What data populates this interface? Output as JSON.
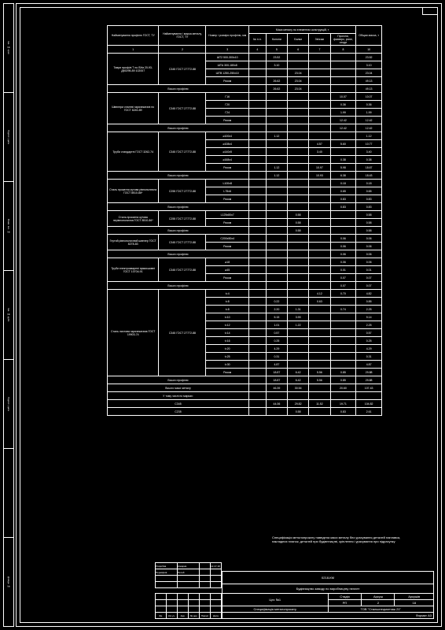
{
  "header": {
    "mass_title": "Маса металу по елементах конструкцій, т",
    "cols": [
      "Найменування профілю ГОСТ, ТУ",
      "Найменування і марка металу, ГОСТ, ТУ",
      "Номер і розміри профілю, мм",
      "№ п.п.",
      "Колoни",
      "Балки",
      "Зв'язки",
      "Прогони, фахверк, різне, сходи",
      "Общая масса, т"
    ],
    "nums": [
      "1",
      "2",
      "3",
      "4",
      "5",
      "6",
      "7",
      "8",
      "9",
      "10"
    ]
  },
  "sections": [
    {
      "name": "Таври профілі Т по ВУм 20-93-ДМЗ/95-89 102007",
      "mat": "С345 ГОСТ 27772-88",
      "rows": [
        {
          "p": "ШТ2 500-300x10",
          "c4": "",
          "c5": "23.52",
          "c6": "",
          "c7": "",
          "c8": "",
          "c9": "23.52"
        },
        {
          "p": "ШТА 300-180x8",
          "c4": "",
          "c5": "3.10",
          "c6": "",
          "c7": "",
          "c8": "",
          "c9": "3.10"
        },
        {
          "p": "ШТВ 1250-250x10",
          "c4": "",
          "c5": "",
          "c6": "23.04",
          "c7": "",
          "c8": "",
          "c9": "23.04"
        },
        {
          "p": "Разом",
          "c4": "",
          "c5": "26.62",
          "c6": "23.04",
          "c7": "",
          "c8": "",
          "c9": "49.13"
        }
      ],
      "total": {
        "p": "Всього профілю",
        "c5": "26.62",
        "c6": "23.04",
        "c7": "",
        "c8": "",
        "c9": "49.13"
      }
    },
    {
      "name": "Швелери сталеві гарячекатані по ГОСТ 8240-89",
      "mat": "С345 ГОСТ 27772-88",
      "rows": [
        {
          "p": "Г16",
          "c4": "",
          "c5": "",
          "c6": "",
          "c7": "",
          "c8": "10.07",
          "c9": "10.07"
        },
        {
          "p": "Г20",
          "c4": "",
          "c5": "",
          "c6": "",
          "c7": "",
          "c8": "0.36",
          "c9": "0.36"
        },
        {
          "p": "Г24",
          "c4": "",
          "c5": "",
          "c6": "",
          "c7": "",
          "c8": "1.99",
          "c9": "1.99"
        },
        {
          "p": "Разом",
          "c4": "",
          "c5": "",
          "c6": "",
          "c7": "",
          "c8": "12.42",
          "c9": "12.42"
        }
      ],
      "total": {
        "p": "Всього профілю",
        "c5": "",
        "c6": "",
        "c7": "",
        "c8": "12.42",
        "c9": "12.42"
      }
    },
    {
      "name": "Труби стандартні ГОСТ 3262-74",
      "mat": "С345 ГОСТ 27772-88",
      "rows": [
        {
          "p": "⌀100x4",
          "c4": "",
          "c5": "1.12",
          "c6": "",
          "c7": "",
          "c8": "",
          "c9": "1.12"
        },
        {
          "p": "⌀108x4",
          "c4": "",
          "c5": "",
          "c6": "",
          "c7": "4.57",
          "c8": "5.60",
          "c9": "10.77"
        },
        {
          "p": "⌀140x5",
          "c4": "",
          "c5": "",
          "c6": "",
          "c7": "3.40",
          "c8": "",
          "c9": "3.40"
        },
        {
          "p": "⌀168x4",
          "c4": "",
          "c5": "",
          "c6": "",
          "c7": "",
          "c8": "0.38",
          "c9": "0.38"
        },
        {
          "p": "Разом",
          "c4": "",
          "c5": "1.12",
          "c6": "",
          "c7": "10.97",
          "c8": "5.98",
          "c9": "18.67"
        }
      ],
      "total": {
        "p": "Всього профілю",
        "c5": "1.12",
        "c6": "",
        "c7": "10.93",
        "c8": "6.38",
        "c9": "18.43"
      }
    },
    {
      "name": "Сталь прокатна кутова рівнополична ГОСТ 8510-86*",
      "mat": "С255 ГОСТ 27772-88",
      "rows": [
        {
          "p": "L100x8",
          "c4": "",
          "c5": "",
          "c6": "",
          "c7": "",
          "c8": "0.18",
          "c9": "0.18"
        },
        {
          "p": "L75x6",
          "c4": "",
          "c5": "",
          "c6": "",
          "c7": "",
          "c8": "0.65",
          "c9": "0.65"
        },
        {
          "p": "Разом",
          "c4": "",
          "c5": "",
          "c6": "",
          "c7": "",
          "c8": "0.83",
          "c9": "0.83"
        }
      ],
      "total": {
        "p": "Всього профілю",
        "c5": "",
        "c6": "",
        "c7": "",
        "c8": "0.83",
        "c9": "0.83"
      }
    },
    {
      "name": "Сталь прокатна кутова нерівнополична ГОСТ 8510-86*",
      "mat": "С255 ГОСТ 27772-88",
      "rows": [
        {
          "p": "L125x80x7",
          "c4": "",
          "c5": "",
          "c6": "0.58",
          "c7": "",
          "c8": "",
          "c9": "0.58"
        },
        {
          "p": "Разом",
          "c4": "",
          "c5": "",
          "c6": "0.58",
          "c7": "",
          "c8": "",
          "c9": "0.58"
        }
      ],
      "total": {
        "p": "Всього профілю",
        "c5": "",
        "c6": "0.58",
        "c7": "",
        "c8": "",
        "c9": "0.58"
      }
    },
    {
      "name": "Гнутий рівнополичний швелер ГОСТ 8278-83",
      "mat": "С345 ГОСТ 27772-88",
      "rows": [
        {
          "p": "С200x50x4",
          "c4": "",
          "c5": "",
          "c6": "",
          "c7": "",
          "c8": "0.06",
          "c9": "0.06"
        },
        {
          "p": "Разом",
          "c4": "",
          "c5": "",
          "c6": "",
          "c7": "",
          "c8": "0.06",
          "c9": "0.06"
        }
      ],
      "total": {
        "p": "Всього профілю",
        "c5": "",
        "c6": "",
        "c7": "",
        "c8": "0.06",
        "c9": "0.06"
      }
    },
    {
      "name": "Труби електрозварені прямошовні ГОСТ 10704-91",
      "mat": "С345 ГОСТ 27772-88",
      "rows": [
        {
          "p": "⌀18",
          "c4": "",
          "c5": "",
          "c6": "",
          "c7": "",
          "c8": "0.06",
          "c9": "0.06"
        },
        {
          "p": "⌀45",
          "c4": "",
          "c5": "",
          "c6": "",
          "c7": "",
          "c8": "0.01",
          "c9": "0.01"
        },
        {
          "p": "Разом",
          "c4": "",
          "c5": "",
          "c6": "",
          "c7": "",
          "c8": "0.07",
          "c9": "0.07"
        }
      ],
      "total": {
        "p": "Всього профілю",
        "c5": "",
        "c6": "",
        "c7": "",
        "c8": "0.07",
        "c9": "0.07"
      }
    },
    {
      "name": "Сталь листова гарячекатана ГОСТ 19903-74",
      "mat": "С345 ГОСТ 27772-88",
      "rows": [
        {
          "p": "t=4",
          "c4": "",
          "c5": "",
          "c6": "",
          "c7": "4.12",
          "c8": "0.70",
          "c9": "4.82"
        },
        {
          "p": "t=8",
          "c4": "",
          "c5": "0.22",
          "c6": "",
          "c7": "0.63",
          "c8": "",
          "c9": "0.85"
        },
        {
          "p": "t=8",
          "c4": "",
          "c5": "2.20",
          "c6": "1.31",
          "c7": "",
          "c8": "0.74",
          "c9": "2.25"
        },
        {
          "p": "t=10",
          "c4": "",
          "c5": "5.15",
          "c6": "3.99",
          "c7": "",
          "c8": "",
          "c9": "9.14"
        },
        {
          "p": "t=12",
          "c4": "",
          "c5": "1.01",
          "c6": "1.22",
          "c7": "",
          "c8": "",
          "c9": "2.25"
        },
        {
          "p": "t=14",
          "c4": "",
          "c5": "0.57",
          "c6": "",
          "c7": "",
          "c8": "",
          "c9": "0.57"
        },
        {
          "p": "t=16",
          "c4": "",
          "c5": "0.25",
          "c6": "",
          "c7": "",
          "c8": "",
          "c9": "0.25"
        },
        {
          "p": "t=20",
          "c4": "",
          "c5": "4.29",
          "c6": "",
          "c7": "",
          "c8": "",
          "c9": "4.29"
        },
        {
          "p": "t=25",
          "c4": "",
          "c5": "0.31",
          "c6": "",
          "c7": "",
          "c8": "",
          "c9": "0.31"
        },
        {
          "p": "t=30",
          "c4": "",
          "c5": "4.87",
          "c6": "",
          "c7": "",
          "c8": "",
          "c9": "4.87"
        },
        {
          "p": "Разом",
          "c4": "",
          "c5": "18.87",
          "c6": "6.42",
          "c7": "5.56",
          "c8": "0.85",
          "c9": "29.88"
        }
      ],
      "total": {
        "p": "Всього профілю",
        "c5": "18.87",
        "c6": "6.42",
        "c7": "5.56",
        "c8": "0.85",
        "c9": "29.88"
      }
    }
  ],
  "totals": [
    {
      "p": "Всього маси металу",
      "c5": "46.39",
      "c6": "30.54",
      "c7": "",
      "c8": "20.60",
      "c9": "107.43"
    },
    {
      "p": "У тому числі по марках:",
      "c5": "",
      "c6": "",
      "c7": "",
      "c8": "",
      "c9": ""
    },
    {
      "p": "С345",
      "c5": "44.06",
      "c6": "29.82",
      "c7": "11.52",
      "c8": "19.71",
      "c9": "104.82"
    },
    {
      "p": "С235",
      "c5": "",
      "c6": "0.58",
      "c7": "",
      "c8": "0.83",
      "c9": "2.61"
    }
  ],
  "note": "Специфікація металопрокату наведена маси металу без урахування деталей наплавок, накладних планок, деталей при будівнництві, кріплення і урахування при підрахунку",
  "titleblock": {
    "code": "0218-КМ",
    "project": "Будівництво заводу по виробництву пеллет",
    "object": "Цех №1",
    "stage_h": "Стадія",
    "sheet_h": "Аркуш",
    "sheets_h": "Аркушів",
    "stage": "РП",
    "sheet": "2",
    "sheets": "18",
    "doc": "Специфікація металопрокату",
    "org": "ТОВ \"Стальспецмонтаж 21\"",
    "format": "Формат    А3",
    "roles": [
      "Розробив",
      "Перевірив"
    ],
    "names": [
      "Кокарєв",
      "Петей"
    ],
    "date": "12.17.18",
    "rev_h": [
      "Зм.",
      "Кіл.уч.",
      "Арк.",
      "№ док.",
      "Підпис",
      "Дата"
    ]
  },
  "strip": [
    "Інв. № ориг.",
    "Підпис і дата",
    "Взам. інв. №",
    "Інв. № дубл.",
    "Підпис і дата",
    "",
    "Довідк. №",
    "Підпис і дата"
  ]
}
